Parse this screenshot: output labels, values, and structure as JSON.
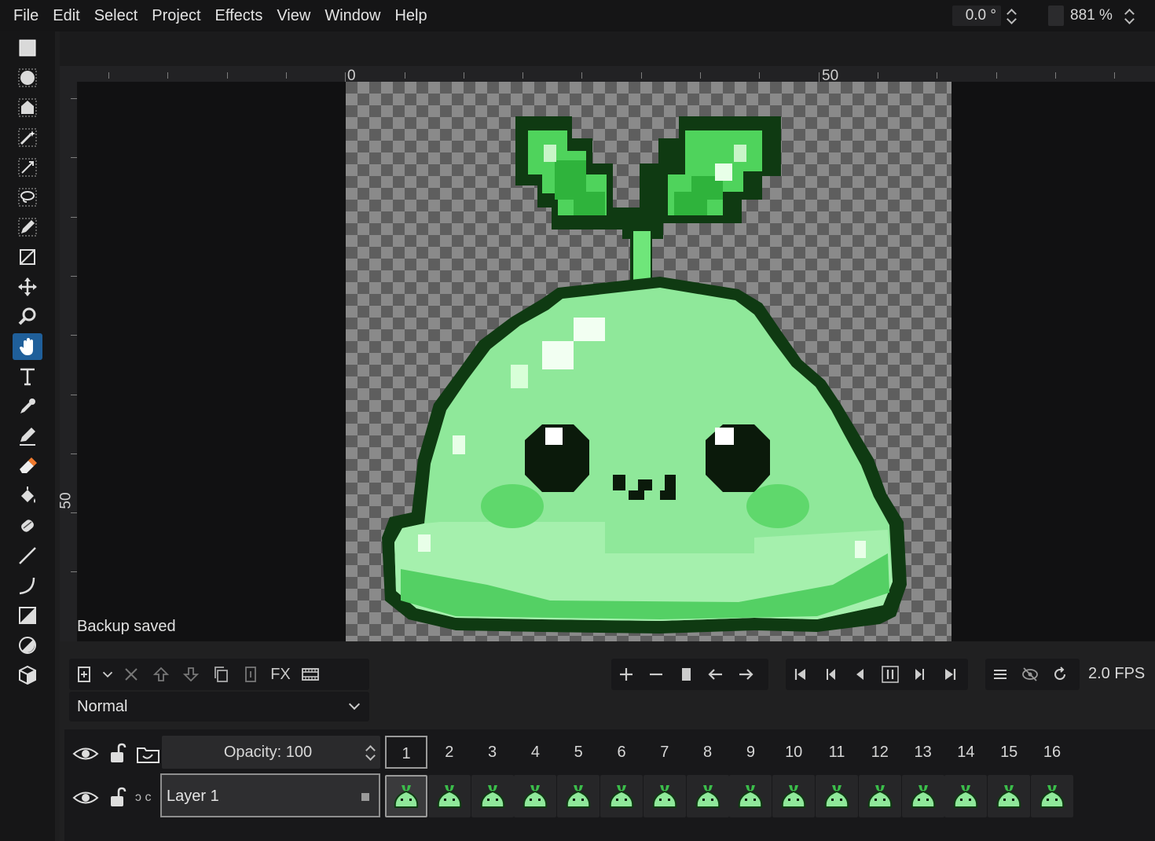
{
  "menu": [
    "File",
    "Edit",
    "Select",
    "Project",
    "Effects",
    "View",
    "Window",
    "Help"
  ],
  "rotation": {
    "value": "0.0 °"
  },
  "zoom": {
    "value": "881 %"
  },
  "ruler": {
    "h_labels": [
      "0",
      "50"
    ],
    "v_labels": [
      "50"
    ]
  },
  "tools": [
    "rectangle-select-icon",
    "ellipse-select-icon",
    "polygon-select-icon",
    "magic-wand-icon",
    "color-select-icon",
    "lasso-icon",
    "pencil-select-icon",
    "crop-icon",
    "move-icon",
    "zoom-icon",
    "pan-icon",
    "text-icon",
    "color-picker-icon",
    "pencil-icon",
    "eraser-icon",
    "bucket-icon",
    "shading-icon",
    "line-icon",
    "curve-icon",
    "rectangle-icon",
    "ellipse-icon",
    "3d-shape-icon"
  ],
  "active_tool": "pan-icon",
  "status": {
    "text": "Backup saved"
  },
  "layer_toolbar": {
    "fx_label": "FX"
  },
  "blend_mode": {
    "value": "Normal"
  },
  "playback": {
    "fps": "2.0 FPS"
  },
  "timeline": {
    "opacity_label": "Opacity: 100",
    "frames": [
      "1",
      "2",
      "3",
      "4",
      "5",
      "6",
      "7",
      "8",
      "9",
      "10",
      "11",
      "12",
      "13",
      "14",
      "15",
      "16"
    ],
    "selected_frame": 1,
    "layer_name": "Layer 1",
    "link_label": "ↄ c"
  },
  "colors": {
    "active_tool": "#1f5f9a",
    "eraser_accent": "#f07a2e",
    "sprite_dark": "#0f3a12",
    "sprite_main": "#8fe89a"
  }
}
